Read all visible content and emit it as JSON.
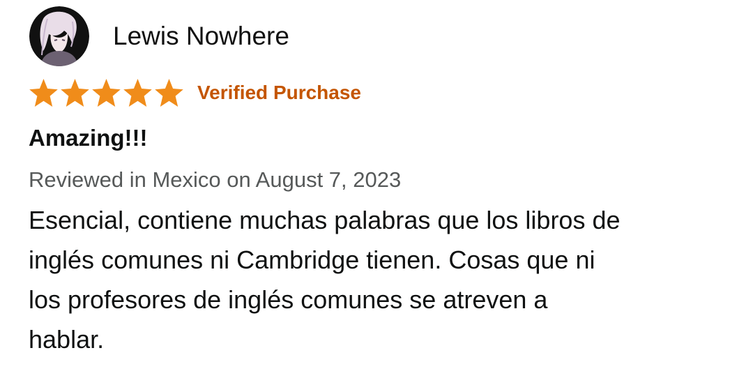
{
  "review": {
    "author": "Lewis Nowhere",
    "avatar_icon": "user-avatar-icon",
    "rating": 5,
    "rating_max": 5,
    "star_color": "#f08c1a",
    "verified_label": "Verified Purchase",
    "verified_color": "#c45500",
    "title": "Amazing!!!",
    "meta": "Reviewed in Mexico on August 7, 2023",
    "body_lines": [
      "Esencial, contiene muchas palabras que los libros de",
      "inglés comunes ni Cambridge tienen. Cosas que ni",
      "los profesores de inglés comunes se atreven a",
      "hablar."
    ]
  }
}
